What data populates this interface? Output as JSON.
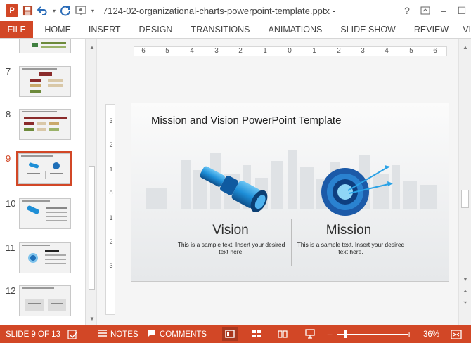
{
  "titlebar": {
    "app_icon": "P",
    "save_icon": "save-icon",
    "undo_icon": "undo-icon",
    "redo_icon": "redo-icon",
    "present_icon": "present-from-beginning-icon",
    "customize_icon": "customize-toolbar-icon",
    "document_title": "7124-02-organizational-charts-powerpoint-template.pptx -",
    "help": "?",
    "restore": "restore-icon",
    "minimize": "–",
    "maximize": "☐"
  },
  "ribbon": {
    "tabs": [
      "FILE",
      "HOME",
      "INSERT",
      "DESIGN",
      "TRANSITIONS",
      "ANIMATIONS",
      "SLIDE SHOW",
      "REVIEW",
      "VI"
    ]
  },
  "thumbnails": {
    "items": [
      {
        "number": "7",
        "active": false
      },
      {
        "number": "8",
        "active": false
      },
      {
        "number": "9",
        "active": true
      },
      {
        "number": "10",
        "active": false
      },
      {
        "number": "11",
        "active": false
      },
      {
        "number": "12",
        "active": false
      }
    ]
  },
  "ruler": {
    "horizontal": [
      "6",
      "5",
      "4",
      "3",
      "2",
      "1",
      "0",
      "1",
      "2",
      "3",
      "4",
      "5",
      "6"
    ],
    "vertical": [
      "3",
      "2",
      "1",
      "0",
      "1",
      "2",
      "3"
    ]
  },
  "slide": {
    "title": "Mission and Vision PowerPoint Template",
    "left_heading": "Vision",
    "left_body": "This is a sample text. Insert your desired text here.",
    "right_heading": "Mission",
    "right_body": "This is a sample text. Insert your desired text here."
  },
  "status": {
    "slide_position": "SLIDE 9 OF 13",
    "notes_label": "NOTES",
    "comments_label": "COMMENTS",
    "zoom": "36%",
    "zoom_minus": "−",
    "zoom_plus": "+"
  },
  "colors": {
    "accent": "#d24726",
    "slide_blue": "#1f8fd6"
  }
}
